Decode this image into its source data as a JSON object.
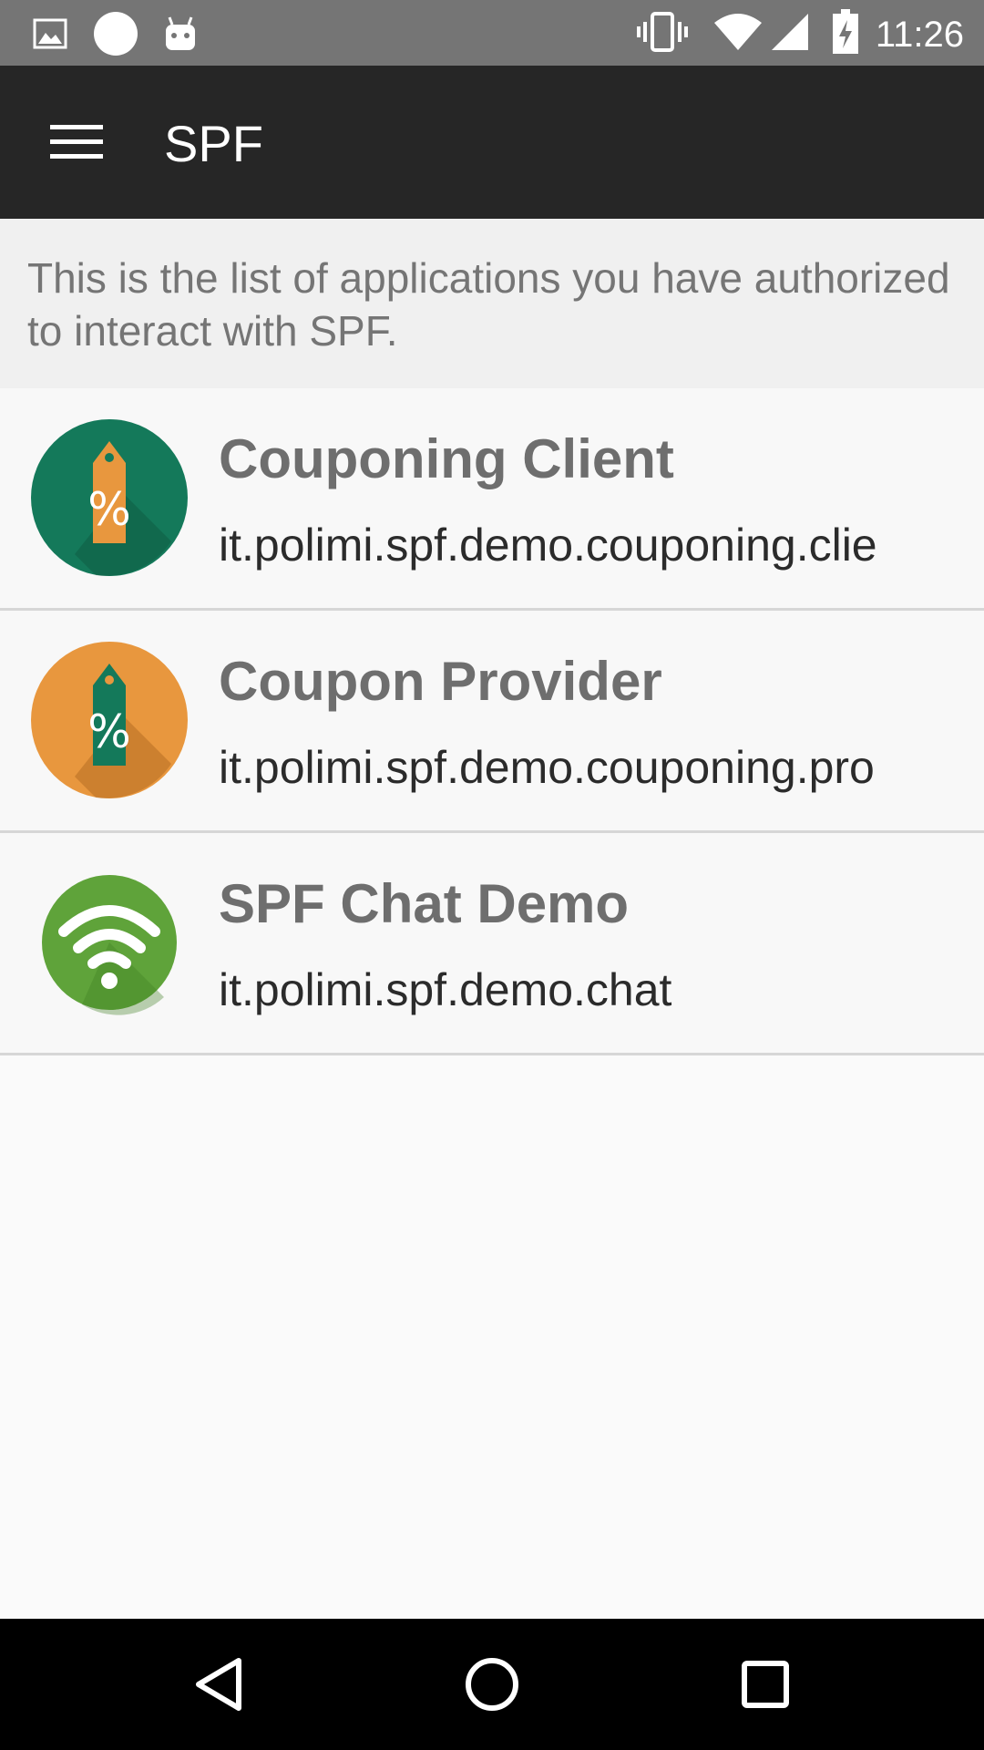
{
  "status_bar": {
    "time": "11:26",
    "left_icons": [
      "image-notification-icon",
      "circle-notification-icon",
      "android-notification-icon"
    ],
    "right_icons": [
      "vibrate-icon",
      "wifi-icon",
      "cell-signal-icon",
      "battery-charging-icon"
    ]
  },
  "app_bar": {
    "menu_icon": "hamburger-menu-icon",
    "title": "SPF"
  },
  "intro_text": "This is the list of applications you have authorized to interact with SPF.",
  "apps": [
    {
      "name": "Couponing Client",
      "package": "it.polimi.spf.demo.couponing.clie",
      "icon": "coupon-client-icon",
      "icon_colors": {
        "circle": "#14795a",
        "tag": "#e8973e"
      }
    },
    {
      "name": "Coupon Provider",
      "package": "it.polimi.spf.demo.couponing.pro",
      "icon": "coupon-provider-icon",
      "icon_colors": {
        "circle": "#e8973e",
        "tag": "#14795a"
      }
    },
    {
      "name": "SPF Chat Demo",
      "package": "it.polimi.spf.demo.chat",
      "icon": "chat-wifi-icon",
      "icon_colors": {
        "circle": "#5fa33a"
      }
    }
  ],
  "nav_bar": {
    "buttons": [
      "back-icon",
      "home-icon",
      "recents-icon"
    ]
  },
  "colors": {
    "app_bar": "#262626",
    "status_bar": "#757575",
    "background": "#fafafa"
  }
}
